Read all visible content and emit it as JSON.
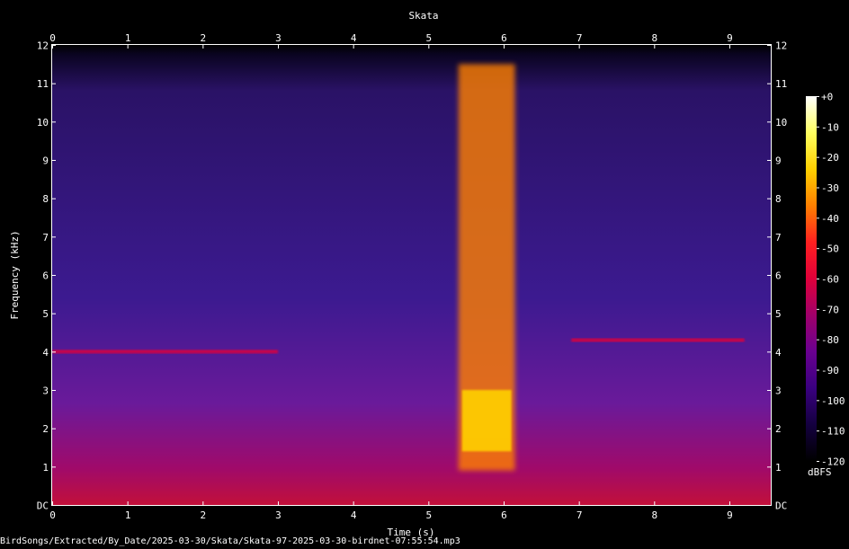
{
  "chart_data": {
    "type": "heatmap",
    "title": "Skata",
    "xlabel": "Time (s)",
    "ylabel": "Frequency (kHz)",
    "xlim": [
      0,
      9.55
    ],
    "ylim": [
      0,
      12
    ],
    "x_ticks": [
      "0",
      "1",
      "2",
      "3",
      "4",
      "5",
      "6",
      "7",
      "8",
      "9"
    ],
    "y_ticks": [
      "DC",
      "1",
      "2",
      "3",
      "4",
      "5",
      "6",
      "7",
      "8",
      "9",
      "10",
      "11",
      "12"
    ],
    "colorbar": {
      "label": "dBFS",
      "range": [
        -120,
        0
      ],
      "ticks": [
        "+0",
        "-10",
        "-20",
        "-30",
        "-40",
        "-50",
        "-60",
        "-70",
        "-80",
        "-90",
        "-100",
        "-110",
        "-120"
      ]
    },
    "colormap": [
      "#ffffff",
      "#ffff60",
      "#ffd000",
      "#ff8000",
      "#ff2020",
      "#e0003a",
      "#a0006a",
      "#6a0090",
      "#3a0080",
      "#140040",
      "#000000"
    ],
    "events": [
      {
        "start_s": 5.4,
        "end_s": 6.15,
        "low_khz": 0.9,
        "high_khz": 11.5,
        "peak_band_khz": [
          1.4,
          3.0
        ],
        "level_dbfs": -40
      },
      {
        "start_s": 0.0,
        "end_s": 3.0,
        "harmonic_khz": 4.0,
        "level_dbfs": -60
      },
      {
        "start_s": 6.9,
        "end_s": 9.2,
        "harmonic_khz": 4.3,
        "level_dbfs": -60
      }
    ]
  },
  "footer_path": "BirdSongs/Extracted/By_Date/2025-03-30/Skata/Skata-97-2025-03-30-birdnet-07:55:54.mp3"
}
